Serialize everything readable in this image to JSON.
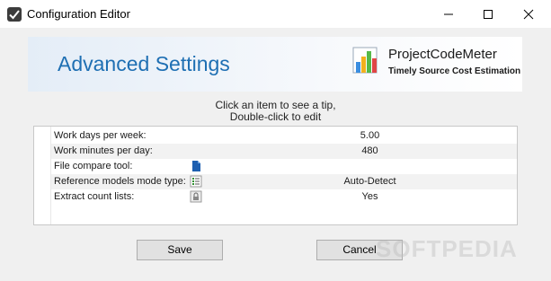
{
  "window": {
    "title": "Configuration Editor",
    "icon": "checkmark-icon"
  },
  "banner": {
    "title": "Advanced Settings",
    "brand_name": "ProjectCodeMeter",
    "brand_tagline": "Timely Source Cost Estimation"
  },
  "tip": {
    "line1": "Click an item to see a tip,",
    "line2": "Double-click to edit"
  },
  "settings": [
    {
      "label": "Work days per week:",
      "value": "5.00",
      "icon": ""
    },
    {
      "label": "Work minutes per day:",
      "value": "480",
      "icon": ""
    },
    {
      "label": "File compare tool:",
      "value": "",
      "icon": "document-icon"
    },
    {
      "label": "Reference models mode type:",
      "value": "Auto-Detect",
      "icon": "list-icon"
    },
    {
      "label": "Extract count lists:",
      "value": "Yes",
      "icon": "lock-icon"
    }
  ],
  "buttons": {
    "save": "Save",
    "cancel": "Cancel"
  },
  "watermark": "SOFTPEDIA",
  "colors": {
    "accent": "#1e6fb3",
    "background": "#f0f0f0"
  }
}
